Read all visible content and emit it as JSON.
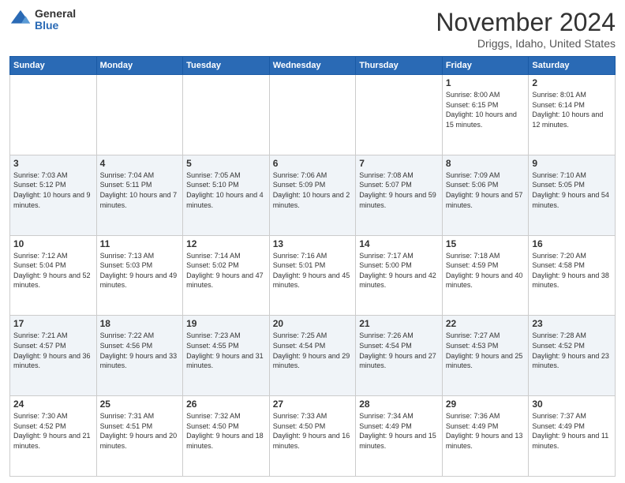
{
  "logo": {
    "general": "General",
    "blue": "Blue"
  },
  "header": {
    "month": "November 2024",
    "location": "Driggs, Idaho, United States"
  },
  "weekdays": [
    "Sunday",
    "Monday",
    "Tuesday",
    "Wednesday",
    "Thursday",
    "Friday",
    "Saturday"
  ],
  "weeks": [
    [
      {
        "day": "",
        "info": ""
      },
      {
        "day": "",
        "info": ""
      },
      {
        "day": "",
        "info": ""
      },
      {
        "day": "",
        "info": ""
      },
      {
        "day": "",
        "info": ""
      },
      {
        "day": "1",
        "info": "Sunrise: 8:00 AM\nSunset: 6:15 PM\nDaylight: 10 hours and 15 minutes."
      },
      {
        "day": "2",
        "info": "Sunrise: 8:01 AM\nSunset: 6:14 PM\nDaylight: 10 hours and 12 minutes."
      }
    ],
    [
      {
        "day": "3",
        "info": "Sunrise: 7:03 AM\nSunset: 5:12 PM\nDaylight: 10 hours and 9 minutes."
      },
      {
        "day": "4",
        "info": "Sunrise: 7:04 AM\nSunset: 5:11 PM\nDaylight: 10 hours and 7 minutes."
      },
      {
        "day": "5",
        "info": "Sunrise: 7:05 AM\nSunset: 5:10 PM\nDaylight: 10 hours and 4 minutes."
      },
      {
        "day": "6",
        "info": "Sunrise: 7:06 AM\nSunset: 5:09 PM\nDaylight: 10 hours and 2 minutes."
      },
      {
        "day": "7",
        "info": "Sunrise: 7:08 AM\nSunset: 5:07 PM\nDaylight: 9 hours and 59 minutes."
      },
      {
        "day": "8",
        "info": "Sunrise: 7:09 AM\nSunset: 5:06 PM\nDaylight: 9 hours and 57 minutes."
      },
      {
        "day": "9",
        "info": "Sunrise: 7:10 AM\nSunset: 5:05 PM\nDaylight: 9 hours and 54 minutes."
      }
    ],
    [
      {
        "day": "10",
        "info": "Sunrise: 7:12 AM\nSunset: 5:04 PM\nDaylight: 9 hours and 52 minutes."
      },
      {
        "day": "11",
        "info": "Sunrise: 7:13 AM\nSunset: 5:03 PM\nDaylight: 9 hours and 49 minutes."
      },
      {
        "day": "12",
        "info": "Sunrise: 7:14 AM\nSunset: 5:02 PM\nDaylight: 9 hours and 47 minutes."
      },
      {
        "day": "13",
        "info": "Sunrise: 7:16 AM\nSunset: 5:01 PM\nDaylight: 9 hours and 45 minutes."
      },
      {
        "day": "14",
        "info": "Sunrise: 7:17 AM\nSunset: 5:00 PM\nDaylight: 9 hours and 42 minutes."
      },
      {
        "day": "15",
        "info": "Sunrise: 7:18 AM\nSunset: 4:59 PM\nDaylight: 9 hours and 40 minutes."
      },
      {
        "day": "16",
        "info": "Sunrise: 7:20 AM\nSunset: 4:58 PM\nDaylight: 9 hours and 38 minutes."
      }
    ],
    [
      {
        "day": "17",
        "info": "Sunrise: 7:21 AM\nSunset: 4:57 PM\nDaylight: 9 hours and 36 minutes."
      },
      {
        "day": "18",
        "info": "Sunrise: 7:22 AM\nSunset: 4:56 PM\nDaylight: 9 hours and 33 minutes."
      },
      {
        "day": "19",
        "info": "Sunrise: 7:23 AM\nSunset: 4:55 PM\nDaylight: 9 hours and 31 minutes."
      },
      {
        "day": "20",
        "info": "Sunrise: 7:25 AM\nSunset: 4:54 PM\nDaylight: 9 hours and 29 minutes."
      },
      {
        "day": "21",
        "info": "Sunrise: 7:26 AM\nSunset: 4:54 PM\nDaylight: 9 hours and 27 minutes."
      },
      {
        "day": "22",
        "info": "Sunrise: 7:27 AM\nSunset: 4:53 PM\nDaylight: 9 hours and 25 minutes."
      },
      {
        "day": "23",
        "info": "Sunrise: 7:28 AM\nSunset: 4:52 PM\nDaylight: 9 hours and 23 minutes."
      }
    ],
    [
      {
        "day": "24",
        "info": "Sunrise: 7:30 AM\nSunset: 4:52 PM\nDaylight: 9 hours and 21 minutes."
      },
      {
        "day": "25",
        "info": "Sunrise: 7:31 AM\nSunset: 4:51 PM\nDaylight: 9 hours and 20 minutes."
      },
      {
        "day": "26",
        "info": "Sunrise: 7:32 AM\nSunset: 4:50 PM\nDaylight: 9 hours and 18 minutes."
      },
      {
        "day": "27",
        "info": "Sunrise: 7:33 AM\nSunset: 4:50 PM\nDaylight: 9 hours and 16 minutes."
      },
      {
        "day": "28",
        "info": "Sunrise: 7:34 AM\nSunset: 4:49 PM\nDaylight: 9 hours and 15 minutes."
      },
      {
        "day": "29",
        "info": "Sunrise: 7:36 AM\nSunset: 4:49 PM\nDaylight: 9 hours and 13 minutes."
      },
      {
        "day": "30",
        "info": "Sunrise: 7:37 AM\nSunset: 4:49 PM\nDaylight: 9 hours and 11 minutes."
      }
    ]
  ]
}
